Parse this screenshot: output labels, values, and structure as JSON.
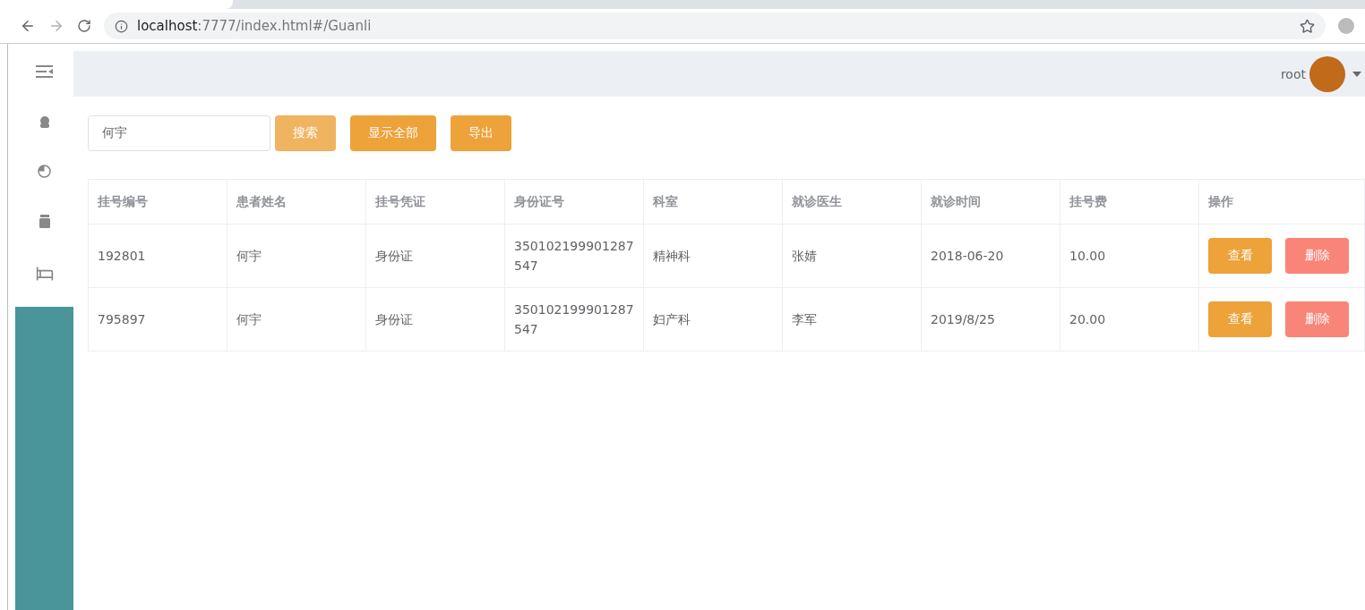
{
  "browser": {
    "url_host": "localhost",
    "url_rest": ":7777/index.html#/Guanli"
  },
  "header": {
    "user": "root"
  },
  "search": {
    "value": "何宇"
  },
  "buttons": [
    {
      "label": "搜索",
      "disabled": true
    },
    {
      "label": "显示全部",
      "disabled": false
    },
    {
      "label": "导出",
      "disabled": false
    }
  ],
  "table": {
    "columns": [
      "挂号编号",
      "患者姓名",
      "挂号凭证",
      "身份证号",
      "科室",
      "就诊医生",
      "就诊时间",
      "挂号费",
      "操作"
    ],
    "rows": [
      {
        "cells": [
          "192801",
          "何宇",
          "身份证",
          "350102199901287547",
          "精神科",
          "张婧",
          "2018-06-20",
          "10.00"
        ],
        "actions": [
          "查看",
          "删除"
        ]
      },
      {
        "cells": [
          "795897",
          "何宇",
          "身份证",
          "350102199901287547",
          "妇产科",
          "李军",
          "2019/8/25",
          "20.00"
        ],
        "actions": [
          "查看",
          "删除"
        ]
      }
    ]
  }
}
